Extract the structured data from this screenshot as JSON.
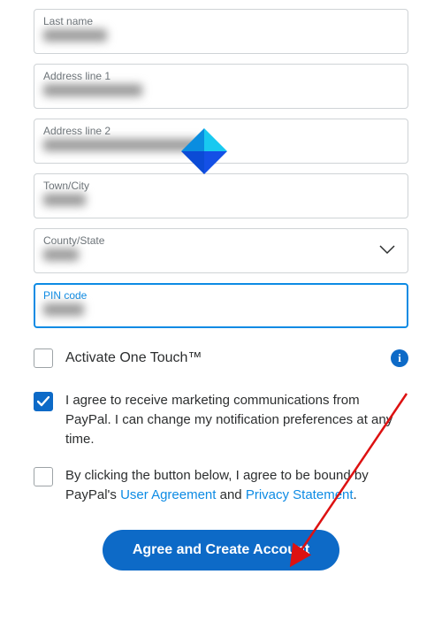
{
  "fields": {
    "last_name": {
      "label": "Last name"
    },
    "address1": {
      "label": "Address line 1"
    },
    "address2": {
      "label": "Address line 2"
    },
    "town": {
      "label": "Town/City"
    },
    "county": {
      "label": "County/State"
    },
    "pin": {
      "label": "PIN code"
    }
  },
  "checkboxes": {
    "onetouch": {
      "label": "Activate One Touch™",
      "checked": false
    },
    "marketing": {
      "label": "I agree to receive marketing communications from PayPal. I can change my notification preferences at any time.",
      "checked": true
    },
    "terms": {
      "prefix": "By clicking the button below, I agree to be bound by PayPal's ",
      "link1": "User Agreement",
      "mid": " and ",
      "link2": "Privacy Statement",
      "suffix": ".",
      "checked": false
    }
  },
  "button": {
    "label": "Agree and Create Account"
  },
  "info_glyph": "i"
}
